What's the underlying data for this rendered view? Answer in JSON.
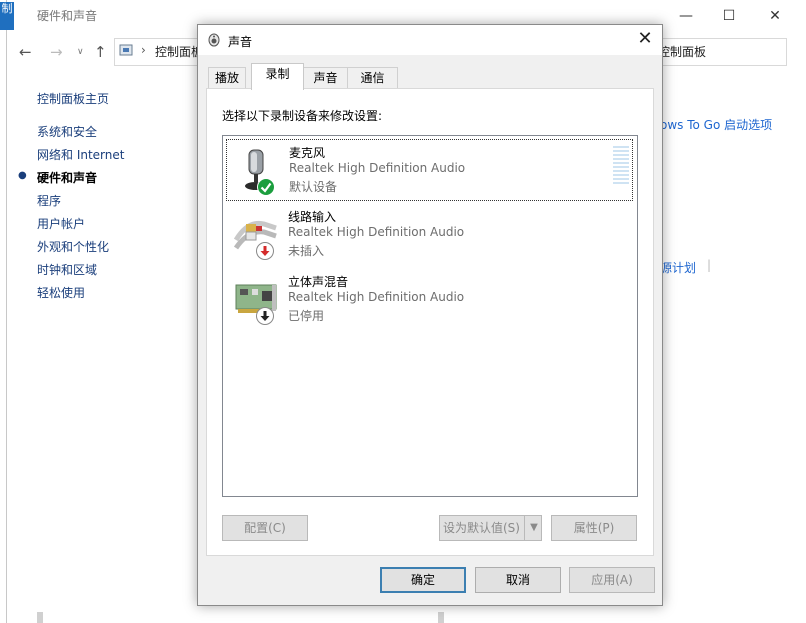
{
  "background_window": {
    "title_icon_text": "制",
    "title": "硬件和声音",
    "address_text": "控制面板",
    "address_right_text": "控制面板",
    "sidebar": {
      "home": "控制面板主页",
      "items": [
        "系统和安全",
        "网络和 Internet",
        "硬件和声音",
        "程序",
        "用户帐户",
        "外观和个性化",
        "时钟和区域",
        "轻松使用"
      ]
    },
    "right_links": [
      "ows To Go 启动选项",
      "源计划"
    ]
  },
  "dialog": {
    "title": "声音",
    "tabs": [
      "播放",
      "录制",
      "声音",
      "通信"
    ],
    "active_tab": "录制",
    "instruction": "选择以下录制设备来修改设置:",
    "devices": [
      {
        "name": "麦克风",
        "driver": "Realtek High Definition Audio",
        "status": "默认设备",
        "icon": "microphone-icon",
        "badge": "check-badge"
      },
      {
        "name": "线路输入",
        "driver": "Realtek High Definition Audio",
        "status": "未插入",
        "icon": "line-in-icon",
        "badge": "down-arrow-red-badge"
      },
      {
        "name": "立体声混音",
        "driver": "Realtek High Definition Audio",
        "status": "已停用",
        "icon": "sound-card-icon",
        "badge": "down-arrow-black-badge"
      }
    ],
    "buttons": {
      "configure": "配置(C)",
      "set_default": "设为默认值(S)",
      "properties": "属性(P)",
      "ok": "确定",
      "cancel": "取消",
      "apply": "应用(A)"
    },
    "colors": {
      "accent": "#3c7fb1",
      "check_green": "#1b9e3e",
      "badge_red": "#d42b2b"
    }
  }
}
